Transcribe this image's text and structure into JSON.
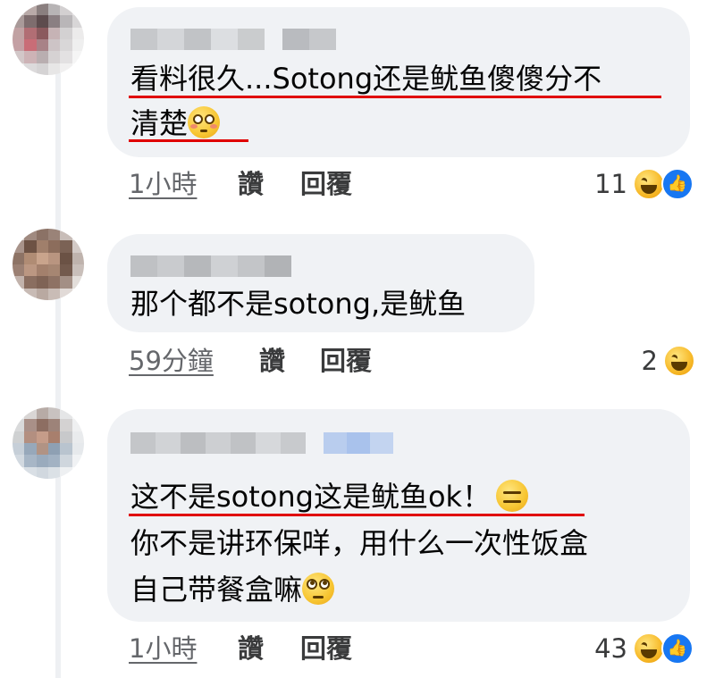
{
  "comments": [
    {
      "lines": [
        "看料很久...Sotong还是鱿鱼傻傻分不",
        "清楚"
      ],
      "emoji_name": "flushed-face-icon",
      "time": "1小時",
      "like_label": "讚",
      "reply_label": "回覆",
      "reaction_count": "11",
      "reactions": [
        "laughing-emoji-icon",
        "like-thumb-icon"
      ]
    },
    {
      "lines": [
        "那个都不是sotong,是鱿鱼"
      ],
      "time": "59分鐘",
      "like_label": "讚",
      "reply_label": "回覆",
      "reaction_count": "2",
      "reactions": [
        "laughing-emoji-icon"
      ]
    },
    {
      "lines": [
        "这不是sotong这是鱿鱼ok！",
        "你不是讲环保咩，用什么一次性饭盒",
        "自己带餐盒嘛"
      ],
      "emoji_names": [
        "expressionless-face-icon",
        "rolling-eyes-face-icon"
      ],
      "time": "1小時",
      "like_label": "讚",
      "reply_label": "回覆",
      "reaction_count": "43",
      "reactions": [
        "laughing-emoji-icon",
        "like-thumb-icon"
      ]
    }
  ],
  "colors": {
    "bubble": "#f0f2f5",
    "underline": "#e00000",
    "like_blue": "#1877f2"
  }
}
